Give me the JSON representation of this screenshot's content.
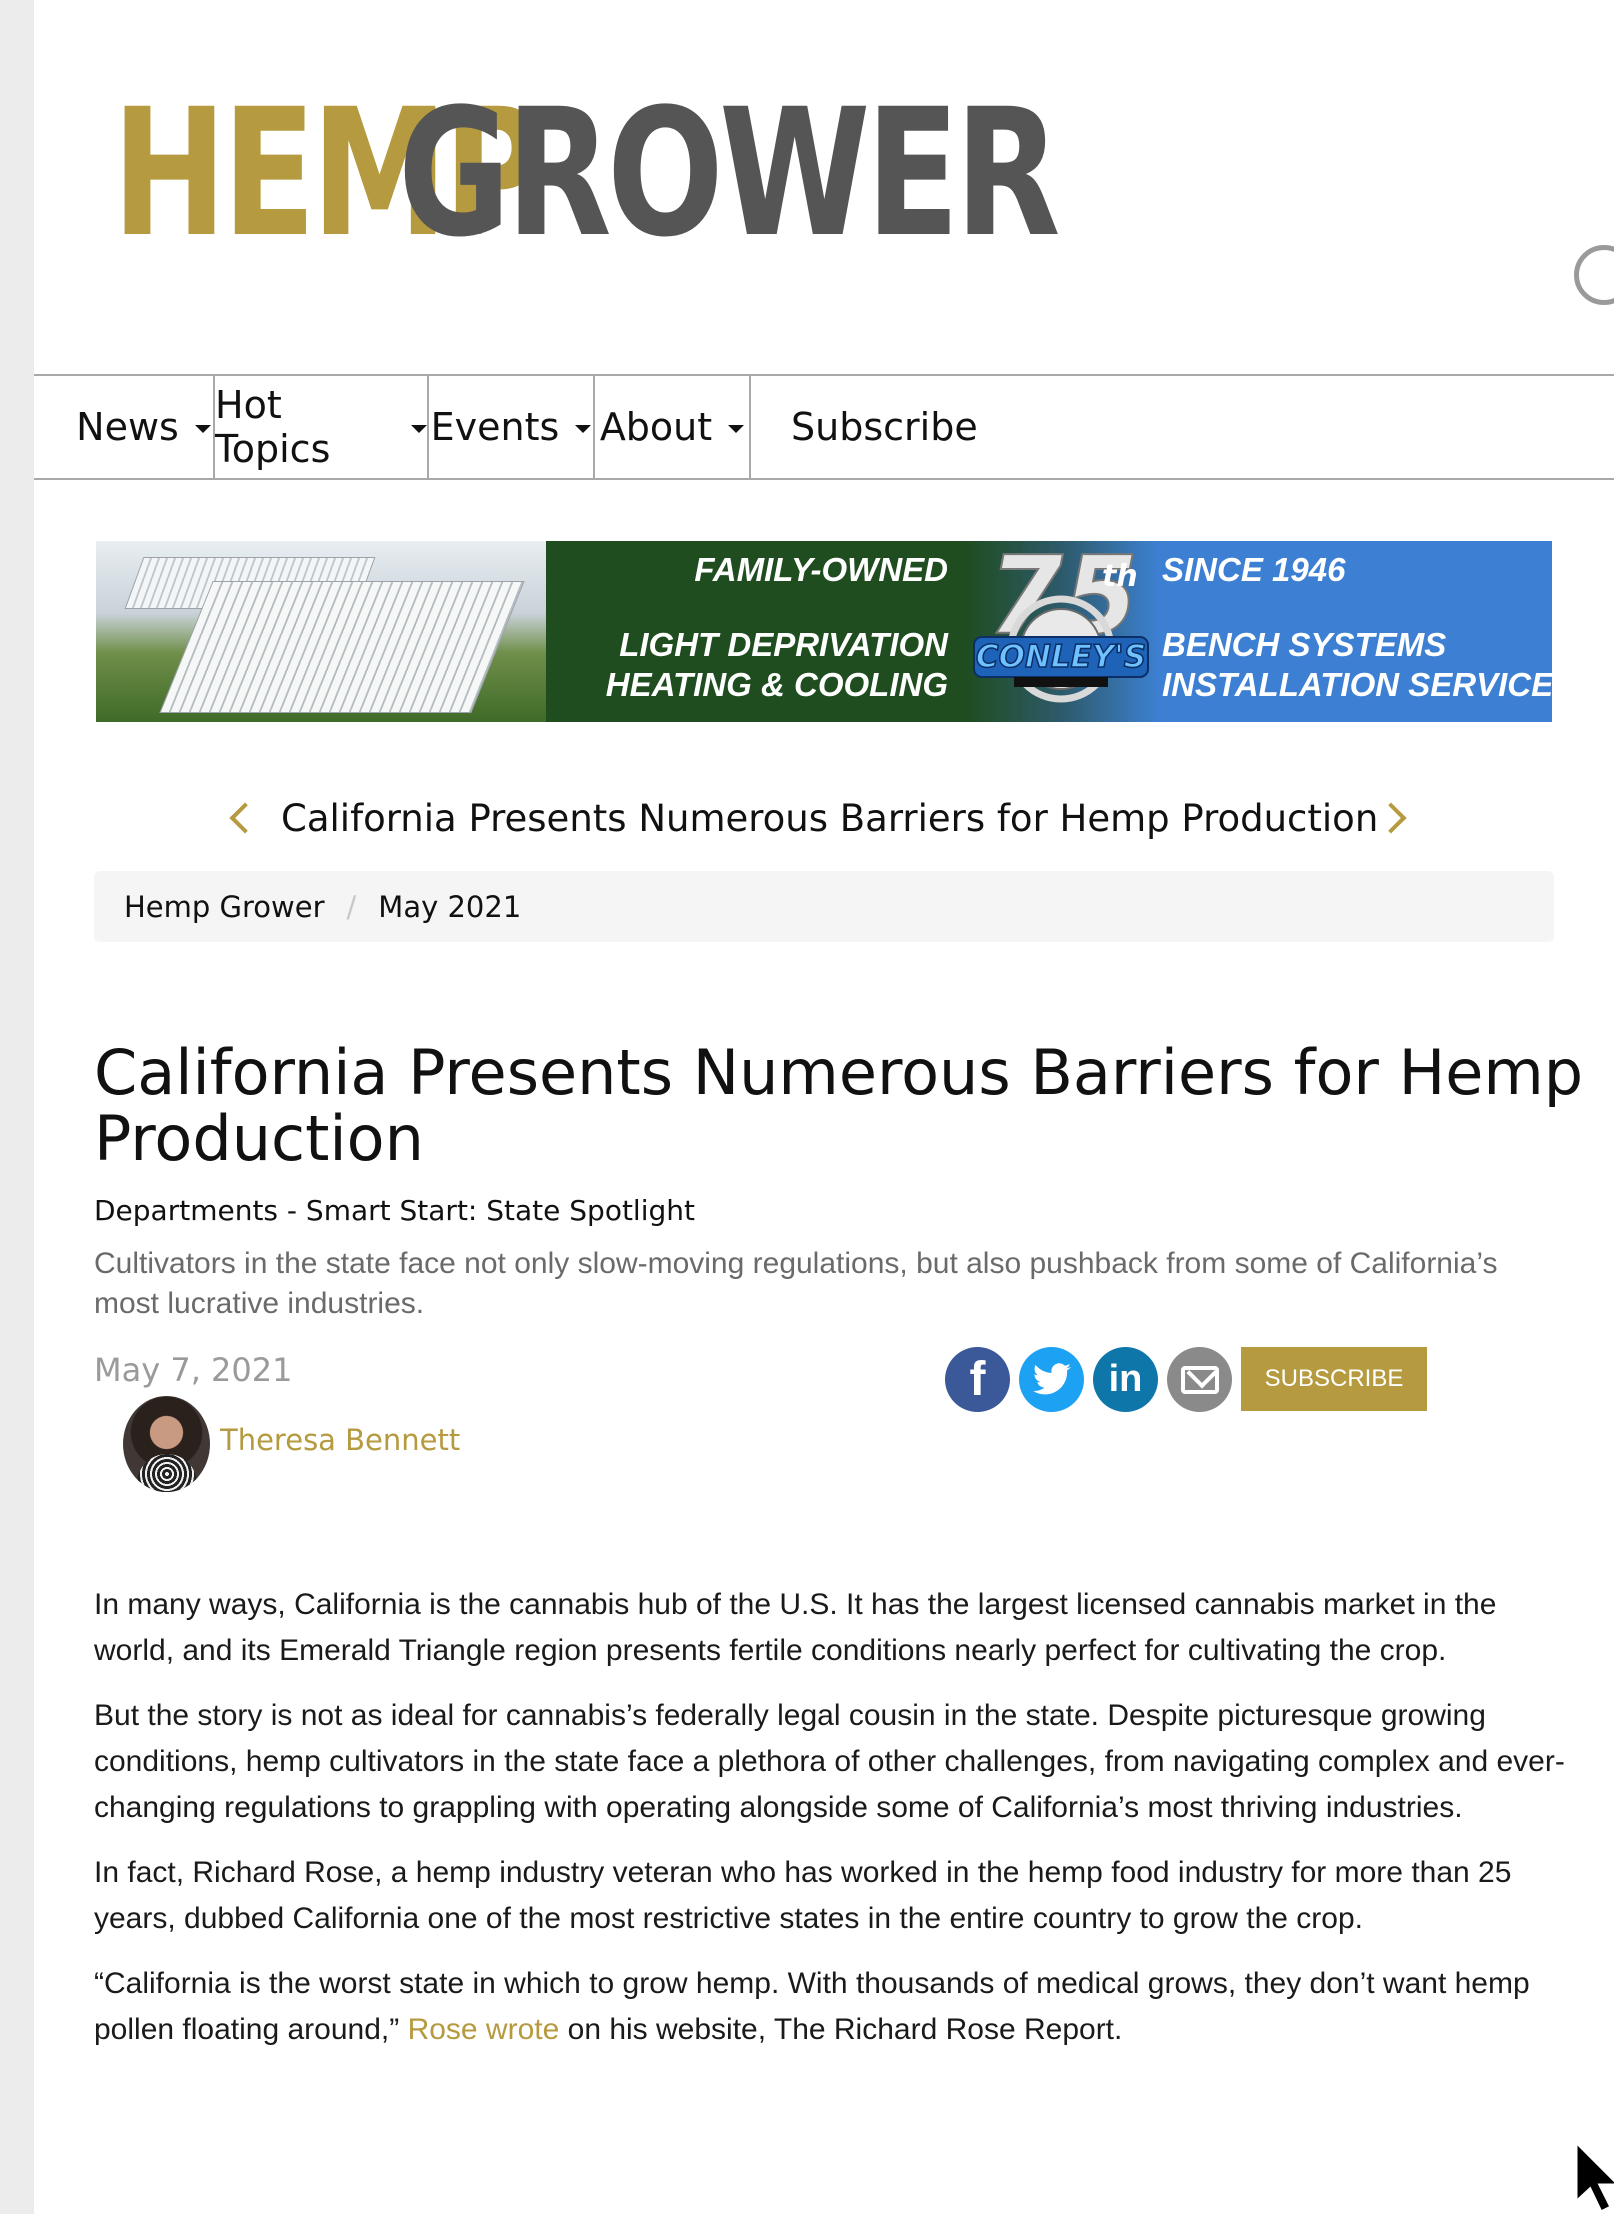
{
  "header": {
    "logo_part1": "HEMP",
    "logo_part2": "GROWER",
    "social_icon": "twitter-icon"
  },
  "nav": {
    "items": [
      {
        "label": "News",
        "dropdown": true
      },
      {
        "label": "Hot Topics",
        "dropdown": true
      },
      {
        "label": "Events",
        "dropdown": true
      },
      {
        "label": "About",
        "dropdown": true
      },
      {
        "label": "Subscribe",
        "dropdown": false
      }
    ]
  },
  "banner": {
    "left_top": "FAMILY-OWNED",
    "left_line1": "LIGHT DEPRIVATION",
    "left_line2": "HEATING & COOLING",
    "emblem_number": "75",
    "emblem_suffix": "th",
    "emblem_brand": "CONLEY'S",
    "right_top": "SINCE 1946",
    "right_line1": "BENCH SYSTEMS",
    "right_line2": "INSTALLATION SERVICES"
  },
  "article_nav": {
    "title": "California Presents Numerous Barriers for Hemp Production"
  },
  "breadcrumb": {
    "items": [
      "Hemp Grower",
      "May 2021"
    ]
  },
  "article": {
    "title": "California Presents Numerous Barriers for Hemp Production",
    "department": "Departments - Smart Start: State Spotlight",
    "deck": "Cultivators in the state face not only slow-moving regulations, but also pushback from some of California’s most lucrative industries.",
    "date": "May 7, 2021",
    "author": "Theresa Bennett",
    "subscribe_label": "SUBSCRIBE",
    "paragraphs": [
      "In many ways, California is the cannabis hub of the U.S. It has the largest licensed cannabis market in the world, and its Emerald Triangle region presents fertile conditions nearly perfect for cultivating the crop.",
      "But the story is not as ideal for cannabis’s federally legal cousin in the state. Despite picturesque growing conditions, hemp cultivators in the state face a plethora of other challenges, from navigating complex and ever-changing regulations to grappling with operating alongside some of California’s most thriving industries.",
      "In fact, Richard Rose, a hemp industry veteran who has worked in the hemp food industry for more than 25 years, dubbed California one of the most restrictive states in the entire country to grow the crop."
    ],
    "quote_before": "“California is the worst state in which to grow hemp. With thousands of medical grows, they don’t want hemp pollen floating around,” ",
    "quote_link": "Rose wrote",
    "quote_after": " on his website, The Richard Rose Report."
  },
  "colors": {
    "gold": "#b59a3f",
    "dark_gray": "#555556",
    "banner_green": "#1f4d20",
    "banner_blue": "#3d7fd2"
  }
}
